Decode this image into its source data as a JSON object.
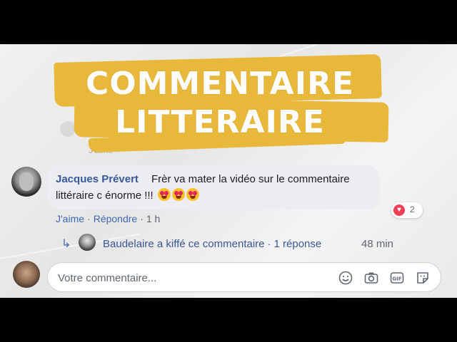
{
  "banner": {
    "line1": "COMMENTAIRE",
    "line2": "LITTERAIRE",
    "color": "#e8b83a"
  },
  "background_comment": {
    "text": "J'aime"
  },
  "comment": {
    "author": "Jacques Prévert",
    "text_line1": "Frèr va mater la vidéo sur le commentaire",
    "text_line2": "littéraire c énorme !!!",
    "emojis": [
      "heart-eyes-emoji",
      "heart-eyes-emoji",
      "heart-eyes-emoji"
    ],
    "actions": {
      "like": "J'aime",
      "separator": "·",
      "reply": "Répondre",
      "time": "1 h"
    },
    "reaction_count": "2"
  },
  "reply_summary": {
    "text": "Baudelaire a kiffé ce commentaire",
    "dot": "·",
    "replies": "1 réponse",
    "time": "48 min"
  },
  "composer": {
    "placeholder": "Votre commentaire...",
    "tools": [
      "emoji-icon",
      "camera-icon",
      "gif-icon",
      "sticker-icon"
    ]
  },
  "colors": {
    "link": "#385898",
    "bubble": "#ebedf0",
    "reaction": "#f33e58"
  }
}
